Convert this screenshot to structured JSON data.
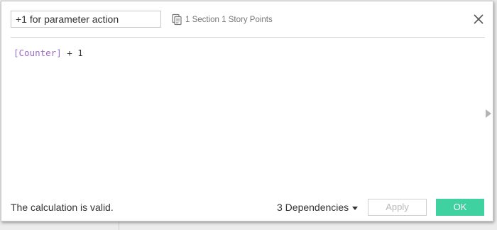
{
  "calculation": {
    "name": "+1 for parameter action",
    "dependencies_summary": "1 Section 1 Story Points",
    "formula": {
      "field": "[Counter]",
      "rest": " + 1"
    }
  },
  "footer": {
    "status": "The calculation is valid.",
    "dependencies_label": "3 Dependencies",
    "apply_label": "Apply",
    "ok_label": "OK"
  },
  "icons": {
    "dependencies": "stacked-sheets-icon",
    "close": "close-icon",
    "expand": "triangle-right-icon",
    "dropdown": "caret-down-icon"
  },
  "colors": {
    "field_reference": "#9b6bc7",
    "ok_button": "#3fd1a0",
    "apply_disabled_text": "#b9b9b9",
    "muted_text": "#777777"
  }
}
